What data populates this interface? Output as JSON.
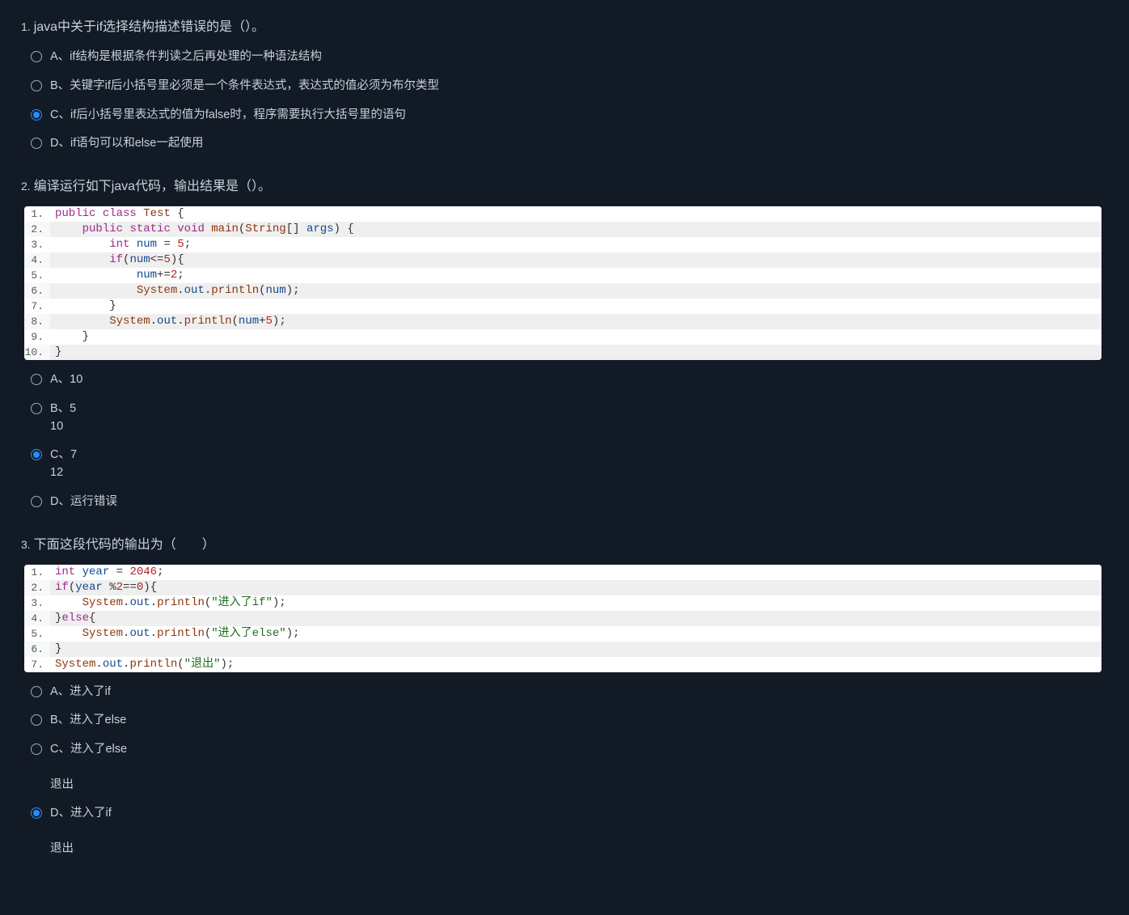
{
  "questions": [
    {
      "number": "1.",
      "title": "java中关于if选择结构描述错误的是（）。",
      "options": [
        {
          "letter": "A、",
          "text": "if结构是根据条件判读之后再处理的一种语法结构",
          "checked": false
        },
        {
          "letter": "B、",
          "text": "关键字if后小括号里必须是一个条件表达式，表达式的值必须为布尔类型",
          "checked": false
        },
        {
          "letter": "C、",
          "text": "if后小括号里表达式的值为false时，程序需要执行大括号里的语句",
          "checked": true
        },
        {
          "letter": "D、",
          "text": "if语句可以和else一起使用",
          "checked": false
        }
      ]
    },
    {
      "number": "2.",
      "title": "编译运行如下java代码，输出结果是（）。",
      "code": [
        [
          [
            "kw",
            "public"
          ],
          [
            "plain",
            " "
          ],
          [
            "kw",
            "class"
          ],
          [
            "plain",
            " "
          ],
          [
            "fn",
            "Test"
          ],
          [
            "plain",
            " "
          ],
          [
            "pun",
            "{"
          ]
        ],
        [
          [
            "plain",
            "    "
          ],
          [
            "kw",
            "public"
          ],
          [
            "plain",
            " "
          ],
          [
            "kw",
            "static"
          ],
          [
            "plain",
            " "
          ],
          [
            "kw",
            "void"
          ],
          [
            "plain",
            " "
          ],
          [
            "fn",
            "main"
          ],
          [
            "pun",
            "("
          ],
          [
            "fn",
            "String"
          ],
          [
            "pun",
            "[]"
          ],
          [
            "plain",
            " "
          ],
          [
            "var",
            "args"
          ],
          [
            "pun",
            ")"
          ],
          [
            "plain",
            " "
          ],
          [
            "pun",
            "{"
          ]
        ],
        [
          [
            "plain",
            "        "
          ],
          [
            "kw",
            "int"
          ],
          [
            "plain",
            " "
          ],
          [
            "var",
            "num"
          ],
          [
            "plain",
            " "
          ],
          [
            "op",
            "="
          ],
          [
            "plain",
            " "
          ],
          [
            "num",
            "5"
          ],
          [
            "pun",
            ";"
          ]
        ],
        [
          [
            "plain",
            "        "
          ],
          [
            "kw",
            "if"
          ],
          [
            "pun",
            "("
          ],
          [
            "var",
            "num"
          ],
          [
            "op",
            "<="
          ],
          [
            "num",
            "5"
          ],
          [
            "pun",
            ")"
          ],
          [
            "pun",
            "{"
          ]
        ],
        [
          [
            "plain",
            "            "
          ],
          [
            "var",
            "num"
          ],
          [
            "op",
            "+="
          ],
          [
            "num",
            "2"
          ],
          [
            "pun",
            ";"
          ]
        ],
        [
          [
            "plain",
            "            "
          ],
          [
            "fn",
            "System"
          ],
          [
            "pun",
            "."
          ],
          [
            "var",
            "out"
          ],
          [
            "pun",
            "."
          ],
          [
            "fn",
            "println"
          ],
          [
            "pun",
            "("
          ],
          [
            "var",
            "num"
          ],
          [
            "pun",
            ")"
          ],
          [
            "pun",
            ";"
          ]
        ],
        [
          [
            "plain",
            "        "
          ],
          [
            "pun",
            "}"
          ]
        ],
        [
          [
            "plain",
            "        "
          ],
          [
            "fn",
            "System"
          ],
          [
            "pun",
            "."
          ],
          [
            "var",
            "out"
          ],
          [
            "pun",
            "."
          ],
          [
            "fn",
            "println"
          ],
          [
            "pun",
            "("
          ],
          [
            "var",
            "num"
          ],
          [
            "op",
            "+"
          ],
          [
            "num",
            "5"
          ],
          [
            "pun",
            ")"
          ],
          [
            "pun",
            ";"
          ]
        ],
        [
          [
            "plain",
            "    "
          ],
          [
            "pun",
            "}"
          ]
        ],
        [
          [
            "pun",
            "}"
          ]
        ]
      ],
      "options": [
        {
          "letter": "A、",
          "text": "10",
          "checked": false
        },
        {
          "letter": "B、",
          "text": "5\n10",
          "checked": false
        },
        {
          "letter": "C、",
          "text": "7\n12",
          "checked": true
        },
        {
          "letter": "D、",
          "text": "运行错误",
          "checked": false
        }
      ]
    },
    {
      "number": "3.",
      "title": "下面这段代码的输出为（　　）",
      "code": [
        [
          [
            "kw",
            "int"
          ],
          [
            "plain",
            " "
          ],
          [
            "var",
            "year"
          ],
          [
            "plain",
            " "
          ],
          [
            "op",
            "="
          ],
          [
            "plain",
            " "
          ],
          [
            "num",
            "2046"
          ],
          [
            "pun",
            ";"
          ]
        ],
        [
          [
            "kw",
            "if"
          ],
          [
            "pun",
            "("
          ],
          [
            "var",
            "year"
          ],
          [
            "plain",
            " "
          ],
          [
            "op",
            "%"
          ],
          [
            "num",
            "2"
          ],
          [
            "op",
            "=="
          ],
          [
            "num",
            "0"
          ],
          [
            "pun",
            ")"
          ],
          [
            "pun",
            "{"
          ]
        ],
        [
          [
            "plain",
            "    "
          ],
          [
            "fn",
            "System"
          ],
          [
            "pun",
            "."
          ],
          [
            "var",
            "out"
          ],
          [
            "pun",
            "."
          ],
          [
            "fn",
            "println"
          ],
          [
            "pun",
            "("
          ],
          [
            "str",
            "\"进入了if\""
          ],
          [
            "pun",
            ")"
          ],
          [
            "pun",
            ";"
          ]
        ],
        [
          [
            "pun",
            "}"
          ],
          [
            "kw",
            "else"
          ],
          [
            "pun",
            "{"
          ]
        ],
        [
          [
            "plain",
            "    "
          ],
          [
            "fn",
            "System"
          ],
          [
            "pun",
            "."
          ],
          [
            "var",
            "out"
          ],
          [
            "pun",
            "."
          ],
          [
            "fn",
            "println"
          ],
          [
            "pun",
            "("
          ],
          [
            "str",
            "\"进入了else\""
          ],
          [
            "pun",
            ")"
          ],
          [
            "pun",
            ";"
          ]
        ],
        [
          [
            "pun",
            "}"
          ]
        ],
        [
          [
            "fn",
            "System"
          ],
          [
            "pun",
            "."
          ],
          [
            "var",
            "out"
          ],
          [
            "pun",
            "."
          ],
          [
            "fn",
            "println"
          ],
          [
            "pun",
            "("
          ],
          [
            "str",
            "\"退出\""
          ],
          [
            "pun",
            ")"
          ],
          [
            "pun",
            ";"
          ]
        ]
      ],
      "options": [
        {
          "letter": "A、",
          "text": "进入了if",
          "checked": false
        },
        {
          "letter": "B、",
          "text": "进入了else",
          "checked": false
        },
        {
          "letter": "C、",
          "text": "进入了else\n\n退出",
          "checked": false
        },
        {
          "letter": "D、",
          "text": "进入了if\n\n退出",
          "checked": true
        }
      ]
    }
  ]
}
